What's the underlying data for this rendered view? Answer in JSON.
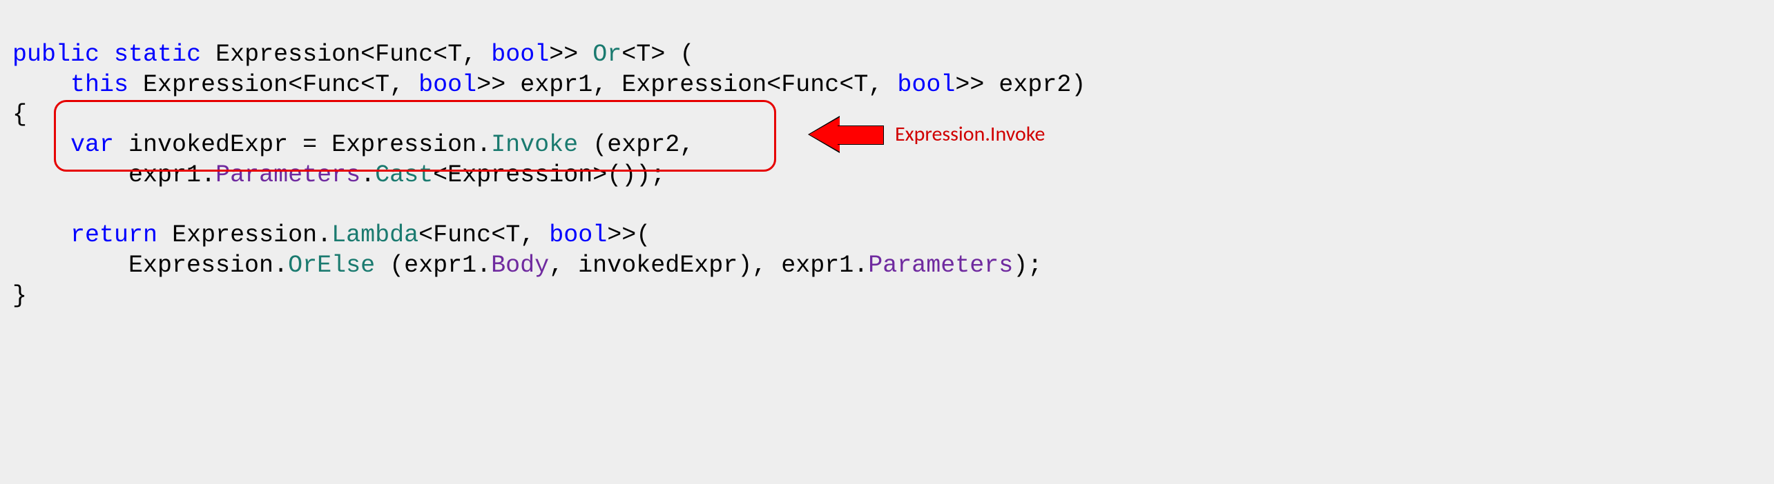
{
  "code": {
    "line1": {
      "public": "public",
      "static": "static",
      "expr": "Expression",
      "lt1": "<",
      "func": "Func",
      "lt2": "<",
      "t": "T",
      "comma": ", ",
      "bool": "bool",
      "gt1": ">>",
      "sp": " ",
      "or": "Or",
      "lt3": "<",
      "t2": "T",
      "gt2": ">",
      "paren": " ("
    },
    "line2": {
      "indent": "    ",
      "this": "this",
      "sp1": " ",
      "expr1": "Expression",
      "lt1": "<",
      "func1": "Func",
      "lt2": "<",
      "t1": "T",
      "c1": ", ",
      "bool1": "bool",
      "gt1": ">>",
      "name1": " expr1, ",
      "expr2": "Expression",
      "lt3": "<",
      "func2": "Func",
      "lt4": "<",
      "t2": "T",
      "c2": ", ",
      "bool2": "bool",
      "gt2": ">>",
      "name2": " expr2)"
    },
    "line3": "{",
    "line4": {
      "indent": "    ",
      "var": "var",
      "name": " invokedExpr = ",
      "expr": "Expression",
      "dot": ".",
      "invoke": "Invoke",
      "args": " (expr2,"
    },
    "line5": {
      "indent": "        ",
      "e1": "expr1",
      "dot1": ".",
      "params": "Parameters",
      "dot2": ".",
      "cast": "Cast",
      "lt": "<",
      "expr": "Expression",
      "gt": ">",
      "end": "());"
    },
    "line7": {
      "indent": "    ",
      "return": "return",
      "sp": " ",
      "expr": "Expression",
      "dot": ".",
      "lambda": "Lambda",
      "lt": "<",
      "func": "Func",
      "lt2": "<",
      "t": "T",
      "c": ", ",
      "bool": "bool",
      "gt": ">>",
      "paren": "("
    },
    "line8": {
      "indent": "        ",
      "expr": "Expression",
      "dot": ".",
      "orelse": "OrElse",
      "args1": " (expr1.",
      "body": "Body",
      "args2": ", invokedExpr), expr1.",
      "params": "Parameters",
      "end": ");"
    },
    "line9": "}"
  },
  "callout": "Expression.Invoke"
}
